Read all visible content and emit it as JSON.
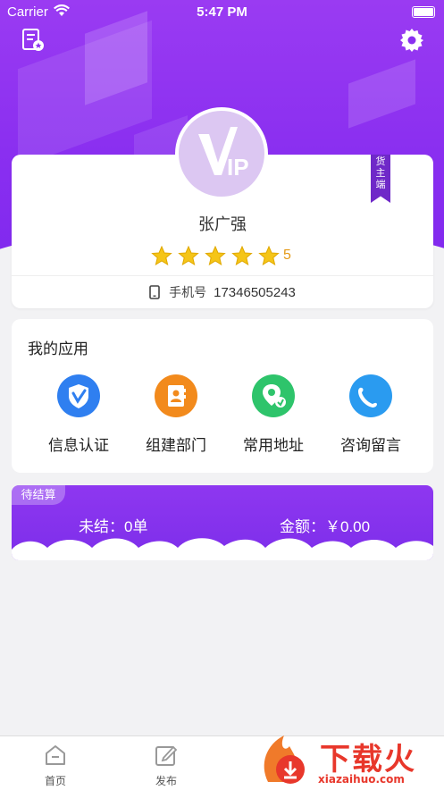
{
  "status": {
    "carrier": "Carrier",
    "time": "5:47 PM"
  },
  "profile": {
    "avatar_text": "VIP",
    "role_badge": [
      "货",
      "主",
      "端"
    ],
    "name": "张广强",
    "rating": 5,
    "rating_label": "5",
    "phone_label": "手机号",
    "phone": "17346505243"
  },
  "apps": {
    "title": "我的应用",
    "items": [
      {
        "label": "信息认证",
        "icon": "shield-v-icon",
        "color": "#2f7ff0"
      },
      {
        "label": "组建部门",
        "icon": "contact-card-icon",
        "color": "#f28a1c"
      },
      {
        "label": "常用地址",
        "icon": "map-pin-icon",
        "color": "#2ec46b"
      },
      {
        "label": "咨询留言",
        "icon": "chat-bubble-icon",
        "color": "#2a9bf0"
      }
    ]
  },
  "settlement": {
    "badge": "待结算",
    "unsettled": "未结：0单",
    "amount": "金额：￥0.00"
  },
  "tabs": [
    {
      "label": "首页",
      "icon": "home-icon"
    },
    {
      "label": "发布",
      "icon": "edit-icon"
    }
  ],
  "watermark": {
    "text": "下载火",
    "url": "xiazaihuo.com"
  },
  "colors": {
    "primary": "#8a2ff0",
    "star": "#f5c518",
    "rating_text": "#e59a18"
  }
}
